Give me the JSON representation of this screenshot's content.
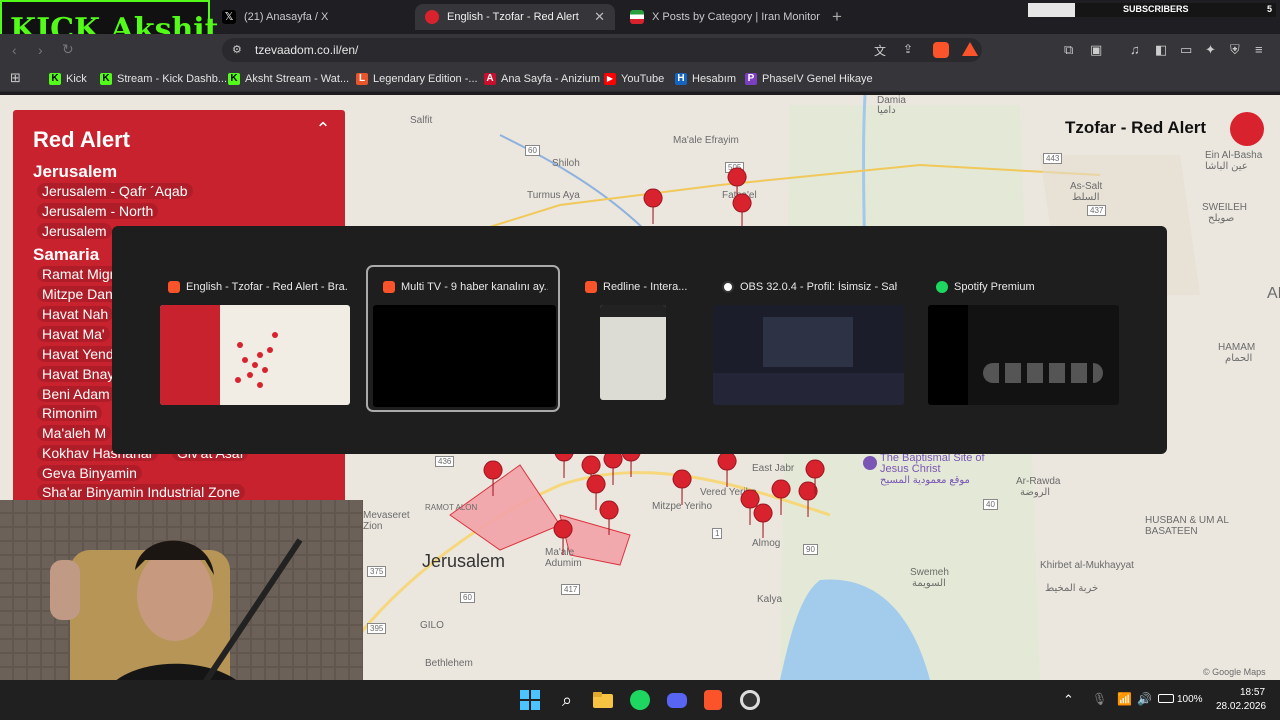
{
  "overlay": {
    "brand": "KICK Akshit",
    "subs_label": "SUBSCRIBERS",
    "subs_count": "5",
    "subs_progress": 0.19
  },
  "tabs": [
    {
      "label": "(21) Anasayfa / X",
      "active": false
    },
    {
      "label": "English - Tzofar - Red Alert",
      "active": true
    },
    {
      "label": "X Posts by Category | Iran Monitor",
      "active": false
    }
  ],
  "address": {
    "url": "tzevaadom.co.il/en/"
  },
  "bookmarks": [
    {
      "label": "Kick",
      "color": "#53fc18",
      "glyph": "K"
    },
    {
      "label": "Stream - Kick Dashb...",
      "color": "#53fc18",
      "glyph": "K"
    },
    {
      "label": "Aksht Stream - Wat...",
      "color": "#53fc18",
      "glyph": "K"
    },
    {
      "label": "Legendary Edition -...",
      "color": "#e8552a",
      "glyph": "L"
    },
    {
      "label": "Ana Sayfa - Anizium",
      "color": "#c8102e",
      "glyph": "A"
    },
    {
      "label": "YouTube",
      "color": "#ff0000",
      "glyph": "▶"
    },
    {
      "label": "Hesabım",
      "color": "#1565c0",
      "glyph": "H"
    },
    {
      "label": "PhaseIV Genel Hikaye",
      "color": "#7b3fbf",
      "glyph": "P"
    }
  ],
  "alert": {
    "title": "Red Alert",
    "regions": [
      {
        "name": "Jerusalem",
        "places": [
          "Jerusalem - Qafr ´Aqab",
          "Jerusalem - North",
          "Jerusalem"
        ]
      },
      {
        "name": "Samaria",
        "places": [
          "Ramat Migr",
          "Mitzpe Dan",
          "Havat Nah",
          "Havat Ma'",
          "Havat Yend",
          "Havat Bnay",
          "Beni Adam",
          "Rimonim",
          "Ma'aleh M",
          "Kokhav Hashahar",
          "Geva Binyamin",
          "Sha'ar Binyamin Industrial Zone"
        ]
      }
    ],
    "extra": "Giv'at Asaf"
  },
  "tzofar": {
    "label": "Tzofar - Red Alert"
  },
  "map": {
    "labels": {
      "salfit": "Salfit",
      "shiloh": "Shiloh",
      "turmus": "Turmus Aya",
      "maale_efrayim": "Ma'ale Efrayim",
      "fatsa": "Fatsa'el",
      "damia": "Damia",
      "damia_ar": "داميا",
      "ain_albasha": "Ein Al-Basha",
      "ain_ar": "عين الباشا",
      "as_salt": "As-Salt",
      "salt_ar": "السلط",
      "sweileh": "SWEILEH",
      "sweileh_ar": "صويلح",
      "jerusalem": "Jerusalem",
      "mevaseret": "Mevaseret Zion",
      "ramot": "RAMOT ALON",
      "gilo": "GILO",
      "bethlehem": "Bethlehem",
      "kalya": "Kalya",
      "sweimeh": "Swemeh",
      "sweimeh_ar": "السويمة",
      "ar_rawda": "Ar-Rawda",
      "rawda_ar": "الروضة",
      "husban": "HUSBAN & UM AL BASATEEN",
      "khirbet": "Khirbet al-Mukhayyat",
      "khirbet_ar": "خربة المخيط",
      "hammam": "HAMAM",
      "hammam_ar": "الحمام",
      "al": "AL",
      "baptismal": "The Baptismal Site of Jesus Christ",
      "baptismal_ar": "موقع معمودية المسيح",
      "vered": "Vered Yeriho",
      "mitzpe": "Mitzpe Yeriho",
      "almog": "Almog",
      "east_jabr": "East Jabr",
      "adumim": "Ma'ale Adumim",
      "google": "© Google Maps",
      "r505": "505",
      "r60": "60",
      "r443": "443",
      "r437": "437",
      "r436": "436",
      "r1": "1",
      "r90": "90",
      "r40": "40",
      "r417": "417",
      "r375": "375",
      "r60b": "60",
      "r395": "395"
    }
  },
  "switcher": {
    "windows": [
      {
        "title": "English - Tzofar - Red Alert - Bra...",
        "icon": "brave-icon"
      },
      {
        "title": "Multi TV - 9 haber kanalını ay...",
        "icon": "brave-icon"
      },
      {
        "title": "Redline - Intera...",
        "icon": "brave-icon"
      },
      {
        "title": "OBS 32.0.4 - Profil: İsimsiz - Sah...",
        "icon": "obs-icon"
      },
      {
        "title": "Spotify Premium",
        "icon": "spotify-icon"
      }
    ]
  },
  "taskbar": {
    "battery": "100%",
    "time": "18:57",
    "date": "28.02.2026"
  }
}
